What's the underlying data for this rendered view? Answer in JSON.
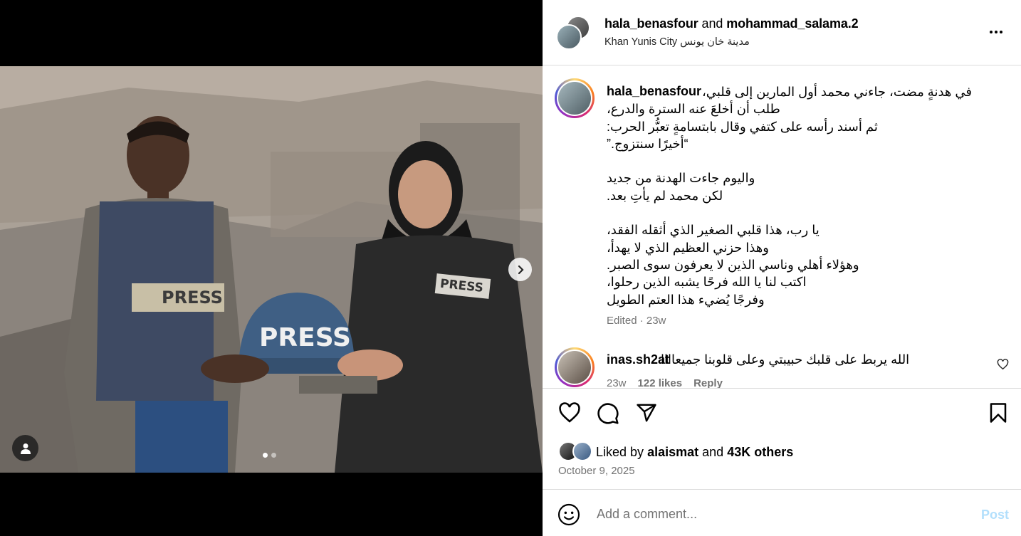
{
  "header": {
    "user1": "hala_benasfour",
    "and": "and",
    "user2": "mohammad_salama.2",
    "location": "Khan Yunis City مدينة خان يونس"
  },
  "caption": {
    "username": "hala_benasfour",
    "lines": [
      "في هدنةٍ مضت، جاءني محمد أول المارين إلى قلبي،",
      "طلب أن أخلعَ عنه السترة والدرع،",
      "ثم أسند رأسه على كتفي وقال بابتسامةٍ تعبُّر الحرب:",
      "“أخيرًا سنتزوج.”",
      "",
      "واليوم جاءت الهدنة من جديد",
      "لكن محمد لم يأتِ بعد.",
      "",
      "يا رب، هذا قلبي الصغير الذي أثقله الفقد،",
      "وهذا حزني العظيم الذي لا يهدأ،",
      "وهؤلاء أهلي وناسي الذين لا يعرفون سوى الصبر.",
      "اكتب لنا يا الله فرحًا يشبه الذين رحلوا،",
      "وفرجًا يُضيء هذا العتم الطويل"
    ],
    "meta": "Edited · 23w"
  },
  "comment": {
    "username": "inas.sh2at",
    "text": "الله يربط على قلبك حبيبتي وعلى قلوبنا جميعاااا",
    "time": "23w",
    "likes": "122 likes",
    "reply": "Reply"
  },
  "photo": {
    "vest_label_1": "PRESS",
    "vest_label_2": "PRESS",
    "helmet_label": "PRESS",
    "carousel_index": 1,
    "carousel_total": 2
  },
  "likes": {
    "prefix": "Liked by",
    "user": "alaismat",
    "and": "and",
    "others": "43K others"
  },
  "date": "October 9, 2025",
  "add_comment": {
    "placeholder": "Add a comment...",
    "post_label": "Post"
  }
}
